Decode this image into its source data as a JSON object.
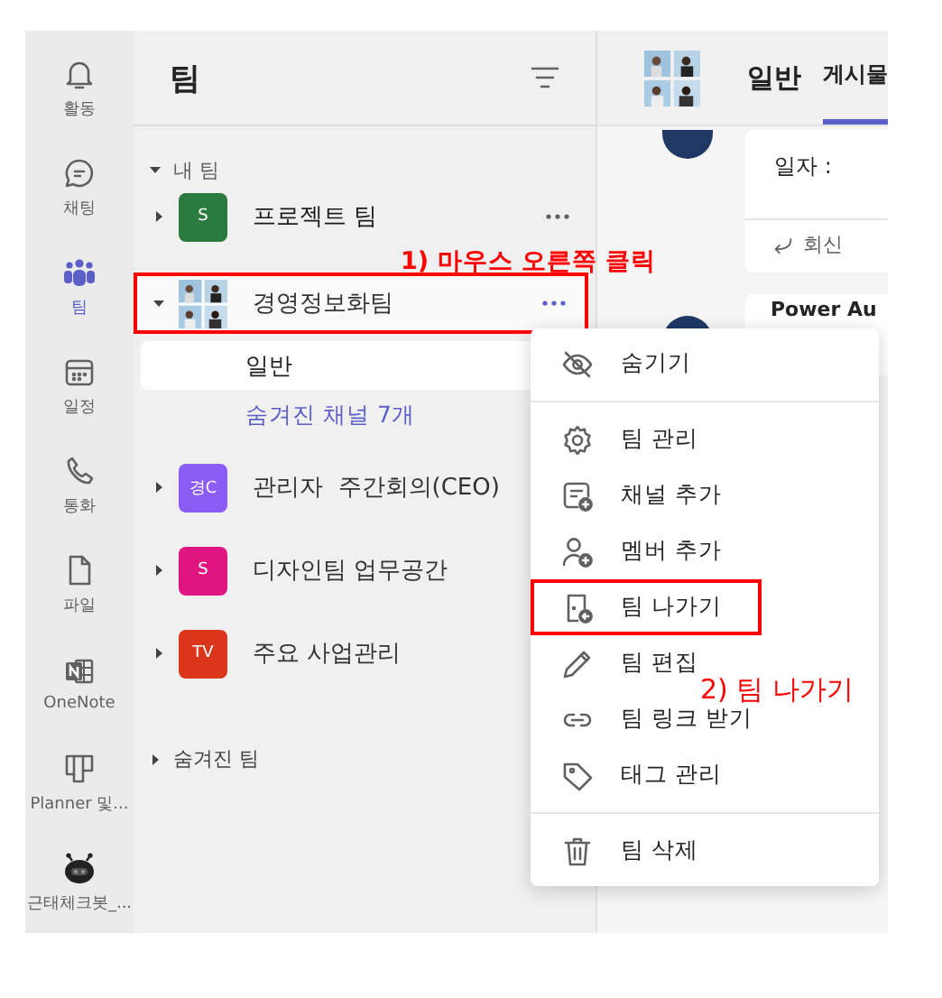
{
  "rail": {
    "items": [
      {
        "label": "활동",
        "selected": false
      },
      {
        "label": "채팅",
        "selected": false
      },
      {
        "label": "팀",
        "selected": true
      },
      {
        "label": "일정",
        "selected": false
      },
      {
        "label": "통화",
        "selected": false
      },
      {
        "label": "파일",
        "selected": false
      },
      {
        "label": "OneNote",
        "selected": false
      },
      {
        "label": "Planner 및...",
        "selected": false
      },
      {
        "label": "근태체크봇_...",
        "selected": false
      }
    ]
  },
  "teams_panel": {
    "title": "팀",
    "section": "내 팀",
    "teams": [
      {
        "name": "프로젝트 팀",
        "avatar": {
          "kind": "initials",
          "text": "S",
          "color": "#2b7a3f"
        },
        "expanded": false,
        "selected": false,
        "hovered": true
      },
      {
        "name": "경영정보화팀",
        "avatar": {
          "kind": "picture"
        },
        "expanded": true,
        "selected": true,
        "hovered": false,
        "channels": [
          {
            "name": "일반",
            "selected": true
          }
        ],
        "hidden_channels": "숨겨진 채널 7개"
      },
      {
        "name": "관리자  주간회의(CEO)",
        "avatar": {
          "kind": "initials",
          "text": "경C",
          "color": "#8b5cf6"
        },
        "expanded": false,
        "selected": false,
        "hovered": false
      },
      {
        "name": "디자인팀 업무공간",
        "avatar": {
          "kind": "initials",
          "text": "S",
          "color": "#e0157f"
        },
        "expanded": false,
        "selected": false,
        "hovered": false
      },
      {
        "name": "주요 사업관리",
        "avatar": {
          "kind": "initials",
          "text": "TV",
          "color": "#d9361b"
        },
        "expanded": false,
        "selected": false,
        "hovered": false
      }
    ],
    "hidden_teams": "숨겨진 팀"
  },
  "channel": {
    "title": "일반",
    "tabs": [
      {
        "label": "게시물",
        "selected": true
      }
    ],
    "posts": [
      {
        "text": "일자 :",
        "reply": "회신"
      },
      {
        "title": "Power Au"
      }
    ]
  },
  "context_menu": {
    "sections": [
      [
        {
          "label": "숨기기",
          "highlighted": false
        }
      ],
      [
        {
          "label": "팀 관리",
          "highlighted": false
        },
        {
          "label": "채널 추가",
          "highlighted": false
        },
        {
          "label": "멤버 추가",
          "highlighted": false
        },
        {
          "label": "팀 나가기",
          "highlighted": true
        },
        {
          "label": "팀 편집",
          "highlighted": false
        },
        {
          "label": "팀 링크 받기",
          "highlighted": false
        },
        {
          "label": "태그 관리",
          "highlighted": false
        }
      ],
      [
        {
          "label": "팀 삭제",
          "highlighted": false
        }
      ]
    ]
  },
  "annotations": [
    {
      "text": "1) 마우스 오른쪽 클릭"
    },
    {
      "text": "2) 팀 나가기"
    }
  ]
}
